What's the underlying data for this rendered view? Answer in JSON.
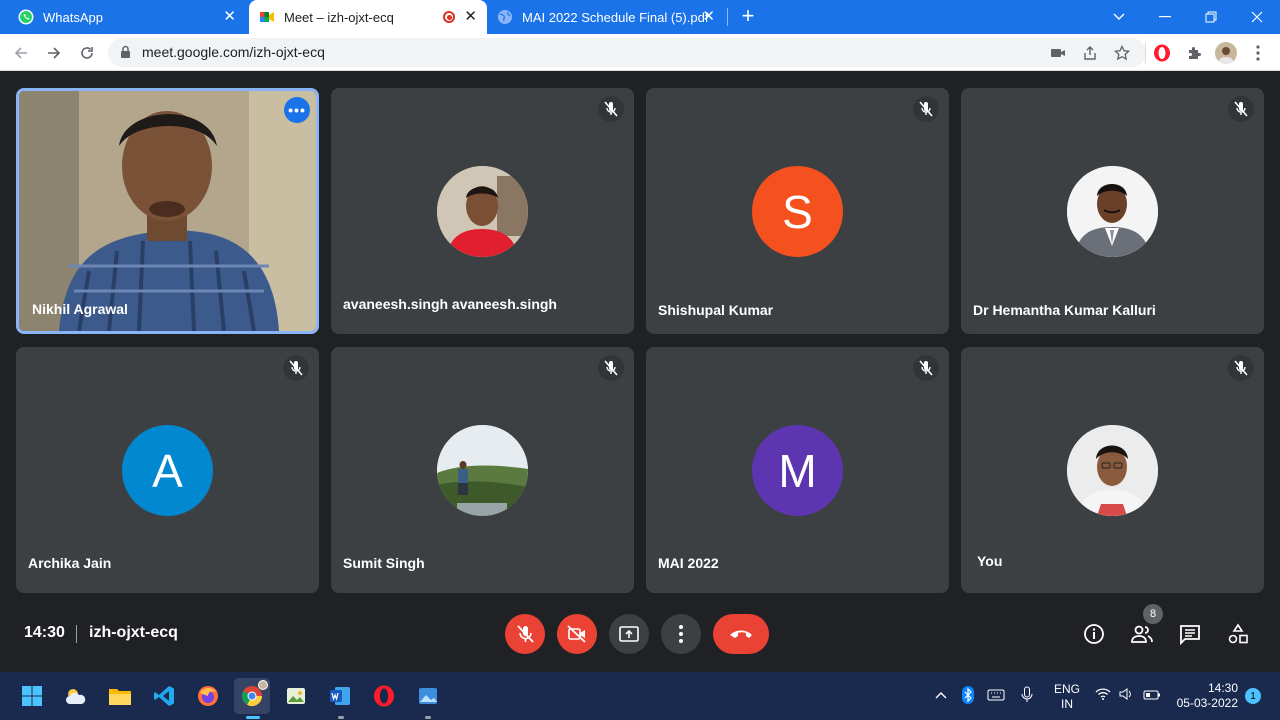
{
  "browser": {
    "tabs": [
      {
        "title": "WhatsApp",
        "icon": "whatsapp-icon"
      },
      {
        "title": "Meet – izh-ojxt-ecq",
        "icon": "google-meet-icon"
      },
      {
        "title": "MAI 2022 Schedule Final (5).pdf",
        "icon": "globe-icon"
      }
    ],
    "new_tab_label": "+",
    "url": "meet.google.com/izh-ojxt-ecq",
    "accent": "#1a73e8"
  },
  "meeting": {
    "time": "14:30",
    "code": "izh-ojxt-ecq",
    "participants_count": "8",
    "more_dots": "•••",
    "participants": [
      {
        "name": "Nikhil Agrawal"
      },
      {
        "name": "avaneesh.singh avaneesh.singh"
      },
      {
        "name": "Shishupal Kumar",
        "initial": "S",
        "color": "#f4511e"
      },
      {
        "name": "Dr Hemantha Kumar Kalluri"
      },
      {
        "name": "Archika Jain",
        "initial": "A",
        "color": "#0288d1"
      },
      {
        "name": "Sumit Singh"
      },
      {
        "name": "MAI 2022",
        "initial": "M",
        "color": "#5e35b1"
      },
      {
        "name": "You"
      }
    ]
  },
  "taskbar": {
    "language_top": "ENG",
    "language_bottom": "IN",
    "time": "14:30",
    "date": "05-03-2022",
    "notifications": "1"
  }
}
